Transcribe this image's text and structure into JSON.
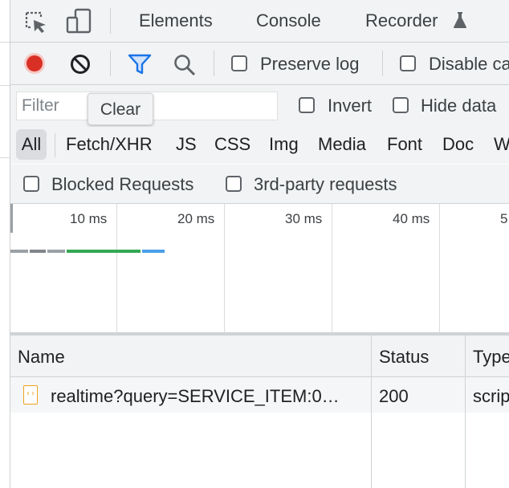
{
  "tabs": [
    {
      "label": "Elements"
    },
    {
      "label": "Console"
    },
    {
      "label": "Recorder"
    }
  ],
  "toolbar": {
    "preserve_log_label": "Preserve log",
    "disable_cache_label": "Disable ca"
  },
  "filter": {
    "placeholder": "Filter",
    "tooltip": "Clear",
    "invert_label": "Invert",
    "hide_data_label": "Hide data"
  },
  "types": [
    "All",
    "Fetch/XHR",
    "JS",
    "CSS",
    "Img",
    "Media",
    "Font",
    "Doc",
    "W"
  ],
  "blocked": {
    "blocked_requests_label": "Blocked Requests",
    "third_party_label": "3rd-party requests"
  },
  "timeline": {
    "ticks": [
      "10 ms",
      "20 ms",
      "30 ms",
      "40 ms",
      "5"
    ]
  },
  "table": {
    "columns": [
      "Name",
      "Status",
      "Type"
    ],
    "rows": [
      {
        "name": "realtime?query=SERVICE_ITEM:0…",
        "status": "200",
        "type": "scrip"
      }
    ]
  },
  "colors": {
    "record": "#d93025",
    "filter_icon": "#1a73e8",
    "bar_gray": "#9aa0a6",
    "bar_green": "#34a853",
    "bar_blue": "#4a9fe8",
    "doc_icon": "#f0a020"
  }
}
